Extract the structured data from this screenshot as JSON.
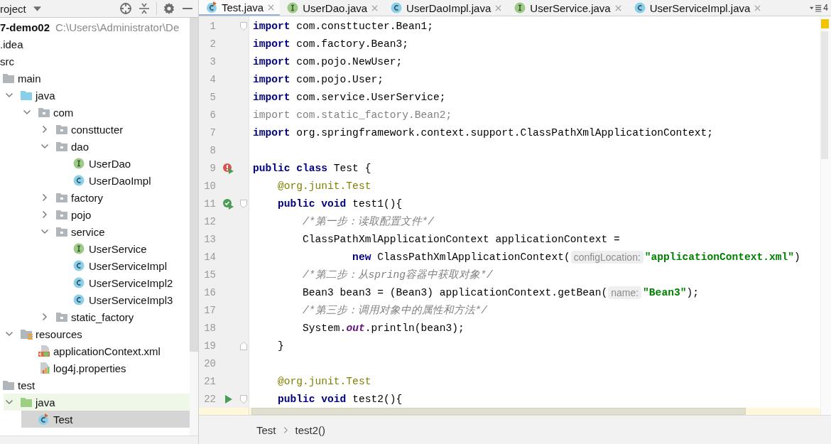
{
  "project_panel": {
    "title": "roject",
    "tree": [
      {
        "label": "7-demo02",
        "path": "C:\\Users\\Administrator\\De",
        "selected": false,
        "children": [
          {
            "label": ".idea",
            "selected": false
          },
          {
            "label": "src",
            "selected": false,
            "children": [
              {
                "label": "main",
                "kind": "folder",
                "expanded": true,
                "selected": false,
                "children": [
                  {
                    "label": "java",
                    "kind": "source-root",
                    "expanded": true,
                    "selected": false,
                    "children": [
                      {
                        "label": "com",
                        "kind": "package",
                        "expanded": true,
                        "selected": false,
                        "children": [
                          {
                            "label": "consttucter",
                            "kind": "package",
                            "expanded": false,
                            "selected": false
                          },
                          {
                            "label": "dao",
                            "kind": "package",
                            "expanded": true,
                            "selected": false,
                            "children": [
                              {
                                "label": "UserDao",
                                "kind": "interface",
                                "selected": false
                              },
                              {
                                "label": "UserDaoImpl",
                                "kind": "class",
                                "selected": false
                              }
                            ]
                          },
                          {
                            "label": "factory",
                            "kind": "package",
                            "expanded": false,
                            "selected": false
                          },
                          {
                            "label": "pojo",
                            "kind": "package",
                            "expanded": false,
                            "selected": false
                          },
                          {
                            "label": "service",
                            "kind": "package",
                            "expanded": true,
                            "selected": false,
                            "children": [
                              {
                                "label": "UserService",
                                "kind": "interface",
                                "selected": false
                              },
                              {
                                "label": "UserServiceImpl",
                                "kind": "class",
                                "selected": false
                              },
                              {
                                "label": "UserServiceImpl2",
                                "kind": "class",
                                "selected": false
                              },
                              {
                                "label": "UserServiceImpl3",
                                "kind": "class",
                                "selected": false
                              }
                            ]
                          },
                          {
                            "label": "static_factory",
                            "kind": "package",
                            "expanded": false,
                            "selected": false
                          }
                        ]
                      }
                    ]
                  },
                  {
                    "label": "resources",
                    "kind": "resources-root",
                    "expanded": true,
                    "selected": false,
                    "children": [
                      {
                        "label": "applicationContext.xml",
                        "kind": "xml-file",
                        "selected": false
                      },
                      {
                        "label": "log4j.properties",
                        "kind": "properties-file",
                        "selected": false
                      }
                    ]
                  }
                ]
              },
              {
                "label": "test",
                "kind": "folder",
                "expanded": true,
                "selected": false,
                "children": [
                  {
                    "label": "java",
                    "kind": "test-root",
                    "expanded": true,
                    "selected": false,
                    "children": [
                      {
                        "label": "Test",
                        "kind": "test-class",
                        "selected": true
                      }
                    ]
                  }
                ]
              }
            ]
          }
        ]
      }
    ]
  },
  "tabs": [
    {
      "label": "Test.java",
      "kind": "test-class",
      "selected": true
    },
    {
      "label": "UserDao.java",
      "kind": "interface",
      "selected": false
    },
    {
      "label": "UserDaoImpl.java",
      "kind": "class",
      "selected": false
    },
    {
      "label": "UserService.java",
      "kind": "interface",
      "selected": false
    },
    {
      "label": "UserServiceImpl.java",
      "kind": "class",
      "selected": false
    }
  ],
  "tab_overflow": "4",
  "lines": [
    {
      "n": "1",
      "fold_marker": {
        "kind": "start"
      },
      "code": [
        {
          "kind": "keyword",
          "t": "import"
        },
        {
          "kind": "plain",
          "t": " com.consttucter.Bean1;"
        }
      ]
    },
    {
      "n": "2",
      "code": [
        {
          "kind": "keyword",
          "t": "import"
        },
        {
          "kind": "plain",
          "t": " com.factory.Bean3;"
        }
      ]
    },
    {
      "n": "3",
      "code": [
        {
          "kind": "keyword",
          "t": "import"
        },
        {
          "kind": "plain",
          "t": " com.pojo.NewUser;"
        }
      ]
    },
    {
      "n": "4",
      "code": [
        {
          "kind": "keyword",
          "t": "import"
        },
        {
          "kind": "plain",
          "t": " com.pojo.User;"
        }
      ]
    },
    {
      "n": "5",
      "code": [
        {
          "kind": "keyword",
          "t": "import"
        },
        {
          "kind": "plain",
          "t": " com.service.UserService;"
        }
      ]
    },
    {
      "n": "6",
      "code": [
        {
          "kind": "unused",
          "t": "import com.static_factory.Bean2;"
        }
      ]
    },
    {
      "n": "7",
      "code": [
        {
          "kind": "keyword",
          "t": "import"
        },
        {
          "kind": "plain",
          "t": " org.springframework.context.support.ClassPathXmlApplicationContext;"
        }
      ]
    },
    {
      "n": "8"
    },
    {
      "n": "9",
      "gutter_icon": {
        "kind": "run-failed"
      },
      "code": [
        {
          "kind": "keyword",
          "t": "public class"
        },
        {
          "kind": "plain",
          "t": " Test {"
        }
      ]
    },
    {
      "n": "10",
      "code": [
        {
          "kind": "annotation",
          "t": "    @org.junit.Test"
        }
      ]
    },
    {
      "n": "11",
      "gutter_icon": {
        "kind": "run-passed"
      },
      "fold_marker": {
        "kind": "start"
      },
      "code": [
        {
          "kind": "keyword",
          "t": "    public void"
        },
        {
          "kind": "plain",
          "t": " test1(){"
        }
      ]
    },
    {
      "n": "12",
      "code": [
        {
          "kind": "comment",
          "t": "        /*第一步：读取配置文件*/"
        }
      ]
    },
    {
      "n": "13",
      "code": [
        {
          "kind": "plain",
          "t": "        ClassPathXmlApplicationContext applicationContext ="
        }
      ]
    },
    {
      "n": "14",
      "code": [
        {
          "kind": "keyword",
          "t": "                new"
        },
        {
          "kind": "plain",
          "t": " ClassPathXmlApplicationContext("
        },
        {
          "kind": "hint",
          "t": "configLocation:"
        },
        {
          "kind": "string",
          "t": "\"applicationContext.xml\""
        },
        {
          "kind": "plain",
          "t": ")"
        }
      ]
    },
    {
      "n": "15",
      "code": [
        {
          "kind": "comment",
          "t": "        /*第二步：从spring容器中获取对象*/"
        }
      ]
    },
    {
      "n": "16",
      "code": [
        {
          "kind": "plain",
          "t": "        Bean3 bean3 = (Bean3) applicationContext.getBean("
        },
        {
          "kind": "hint",
          "t": "name:"
        },
        {
          "kind": "string",
          "t": "\"Bean3\""
        },
        {
          "kind": "plain",
          "t": ");"
        }
      ]
    },
    {
      "n": "17",
      "code": [
        {
          "kind": "comment",
          "t": "        /*第三步：调用对象中的属性和方法*/"
        }
      ]
    },
    {
      "n": "18",
      "code": [
        {
          "kind": "plain",
          "t": "        System."
        },
        {
          "kind": "static-field",
          "t": "out"
        },
        {
          "kind": "plain",
          "t": ".println(bean3);"
        }
      ]
    },
    {
      "n": "19",
      "fold_marker": {
        "kind": "end"
      },
      "code": [
        {
          "kind": "plain",
          "t": "    }"
        }
      ]
    },
    {
      "n": "20"
    },
    {
      "n": "21",
      "code": [
        {
          "kind": "annotation",
          "t": "    @org.junit.Test"
        }
      ]
    },
    {
      "n": "22",
      "gutter_icon": {
        "kind": "run"
      },
      "fold_marker": {
        "kind": "start"
      },
      "code": [
        {
          "kind": "keyword",
          "t": "    public void"
        },
        {
          "kind": "plain",
          "t": " test2(){"
        }
      ]
    }
  ],
  "breadcrumbs": [
    "Test",
    "test2()"
  ]
}
